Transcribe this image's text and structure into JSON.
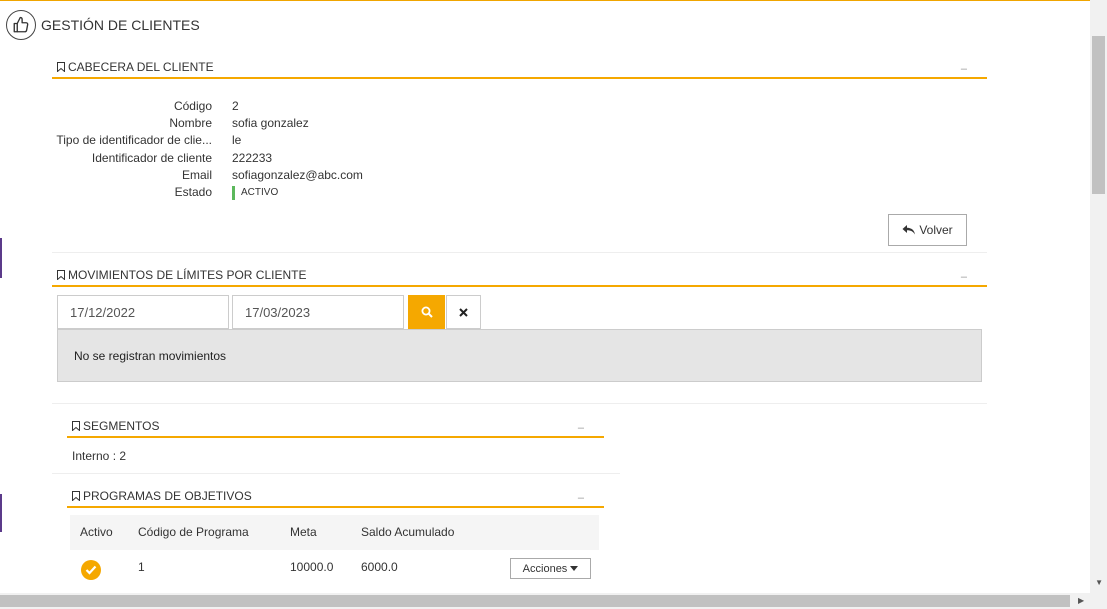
{
  "page": {
    "title": "GESTIÓN DE CLIENTES"
  },
  "cabecera": {
    "title": "CABECERA DEL CLIENTE",
    "collapse": "–",
    "fields": [
      {
        "label": "Código",
        "value": "2"
      },
      {
        "label": "Nombre",
        "value": "sofia gonzalez"
      },
      {
        "label": "Tipo de identificador de clie...",
        "value": "le"
      },
      {
        "label": "Identificador de cliente",
        "value": "222233"
      },
      {
        "label": "Email",
        "value": "sofiagonzalez@abc.com"
      }
    ],
    "estado_label": "Estado",
    "estado_value": "ACTIVO",
    "estado_color": "#5cb85c",
    "volver_label": "Volver"
  },
  "movimientos": {
    "title": "MOVIMIENTOS DE LÍMITES POR CLIENTE",
    "collapse": "–",
    "fecha_desde": "17/12/2022",
    "fecha_hasta": "17/03/2023",
    "empty_message": "No se registran movimientos"
  },
  "segmentos": {
    "title": "SEGMENTOS",
    "collapse": "–",
    "text": "Interno : 2"
  },
  "programas": {
    "title": "PROGRAMAS DE OBJETIVOS",
    "collapse": "–",
    "columns": [
      "Activo",
      "Código de Programa",
      "Meta",
      "Saldo Acumulado"
    ],
    "rows": [
      {
        "codigo": "1",
        "meta": "10000.0",
        "saldo": "6000.0",
        "acciones": "Acciones"
      }
    ]
  },
  "colors": {
    "accent": "#f5a800",
    "success": "#5cb85c"
  }
}
